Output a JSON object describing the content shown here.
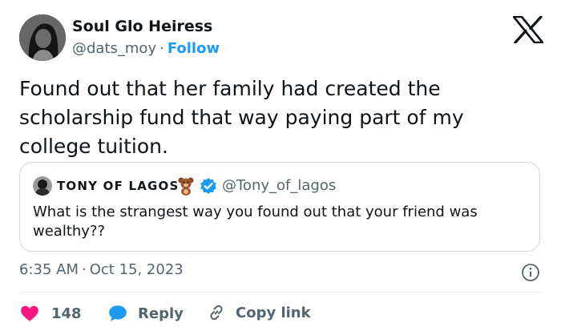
{
  "author": {
    "display_name": "Soul Glo Heiress",
    "handle": "@dats_moy",
    "separator": "·",
    "follow_label": "Follow"
  },
  "tweet": {
    "text": "Found out that her family had created the scholarship fund that way paying part of my college tuition."
  },
  "quoted_tweet": {
    "display_name": "TONY OF LAGOS",
    "handle": "@Tony_of_lagos",
    "text": "What is the strangest way you found out that your friend was wealthy??"
  },
  "meta": {
    "time": "6:35 AM",
    "separator": "·",
    "date": "Oct 15, 2023"
  },
  "actions": {
    "likes_count": "148",
    "reply_label": "Reply",
    "copy_link_label": "Copy link"
  },
  "icons": {
    "logo": "x-logo-icon",
    "verified": "verified-badge-icon",
    "emoji": "teddy-bear-icon",
    "info": "info-icon",
    "like": "heart-icon",
    "reply": "reply-bubble-icon",
    "copy": "link-icon"
  },
  "colors": {
    "accent": "#1d9bf0",
    "like": "#f91880",
    "secondary_text": "#536471",
    "primary_text": "#0f1419",
    "border": "#cfd9de"
  }
}
